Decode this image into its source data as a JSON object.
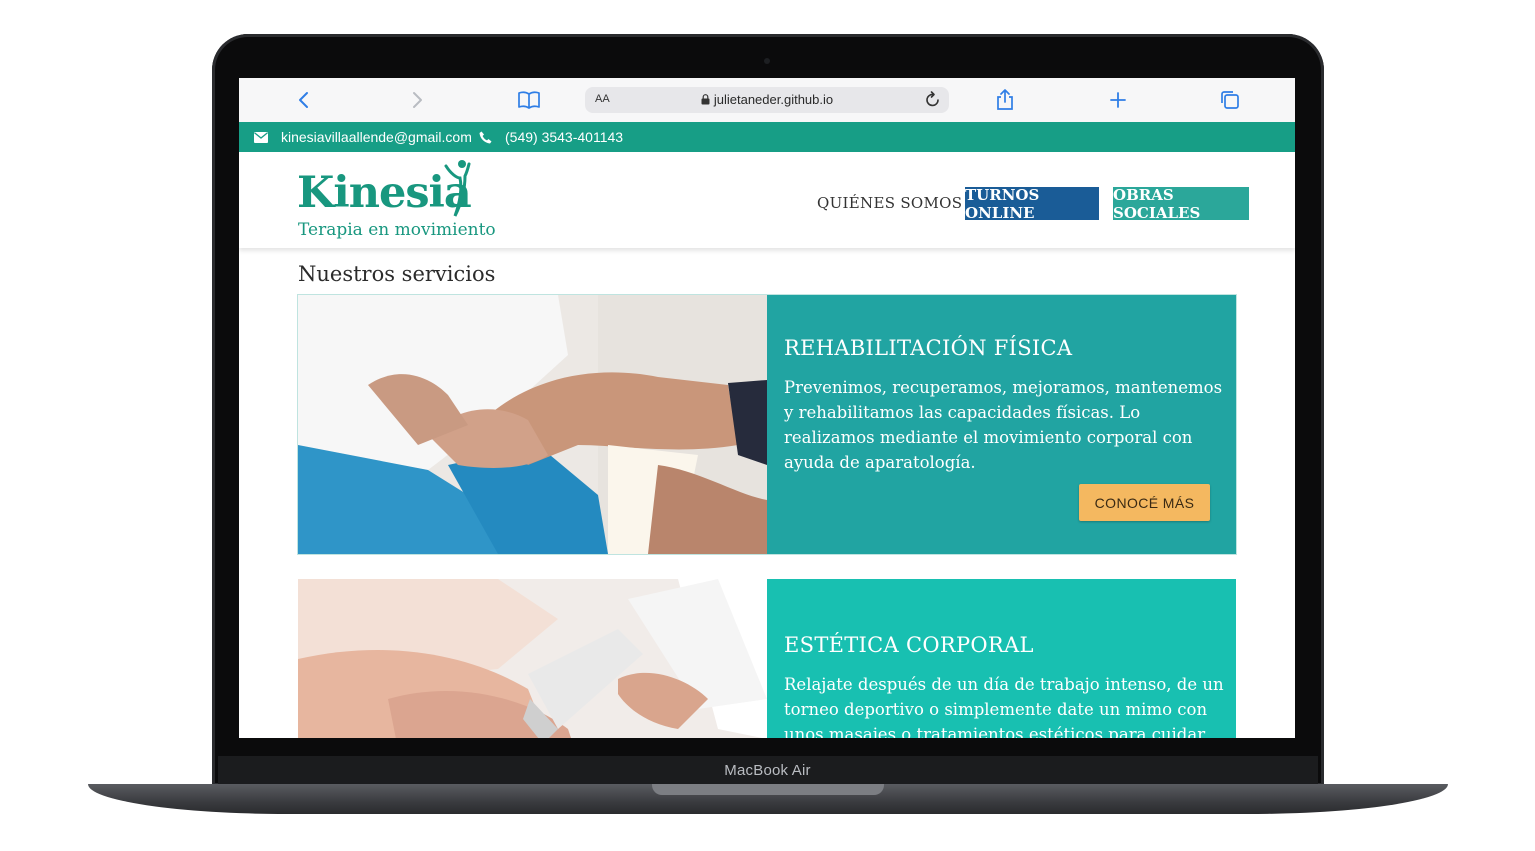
{
  "device": {
    "model": "MacBook Air"
  },
  "browser": {
    "address_aa": "AA",
    "url": "julietaneder.github.io"
  },
  "topbar": {
    "email": "kinesiavillaallende@gmail.com",
    "phone": "(549) 3543-401143"
  },
  "header": {
    "logo_word": "Kinesia",
    "logo_tagline": "Terapia en movimiento",
    "nav": {
      "who": "QUIÉNES SOMOS",
      "turnos": "TURNOS ONLINE",
      "obras": "OBRAS SOCIALES"
    }
  },
  "main": {
    "section_title": "Nuestros servicios",
    "services": [
      {
        "title": "REHABILITACIÓN FÍSICA",
        "text": "Prevenimos, recuperamos, mejoramos, mantenemos y rehabilitamos las capacidades físicas. Lo realizamos mediante el movimiento corporal con ayuda de aparatología.",
        "button": "CONOCÉ MÁS",
        "color": "#21a4a2"
      },
      {
        "title": "ESTÉTICA CORPORAL",
        "text": "Relajate después de un día de trabajo intenso, de un torneo deportivo o simplemente date un mimo con unos masajes o tratamientos estéticos para cuidar tu cuerpo.",
        "color": "#18c0b1"
      }
    ]
  },
  "colors": {
    "topbar": "#179e86",
    "brand": "#18977f",
    "turnos": "#1a5c97",
    "obras": "#2ba79a",
    "cta": "#f4b860",
    "safari_blue": "#2f7ee6"
  }
}
